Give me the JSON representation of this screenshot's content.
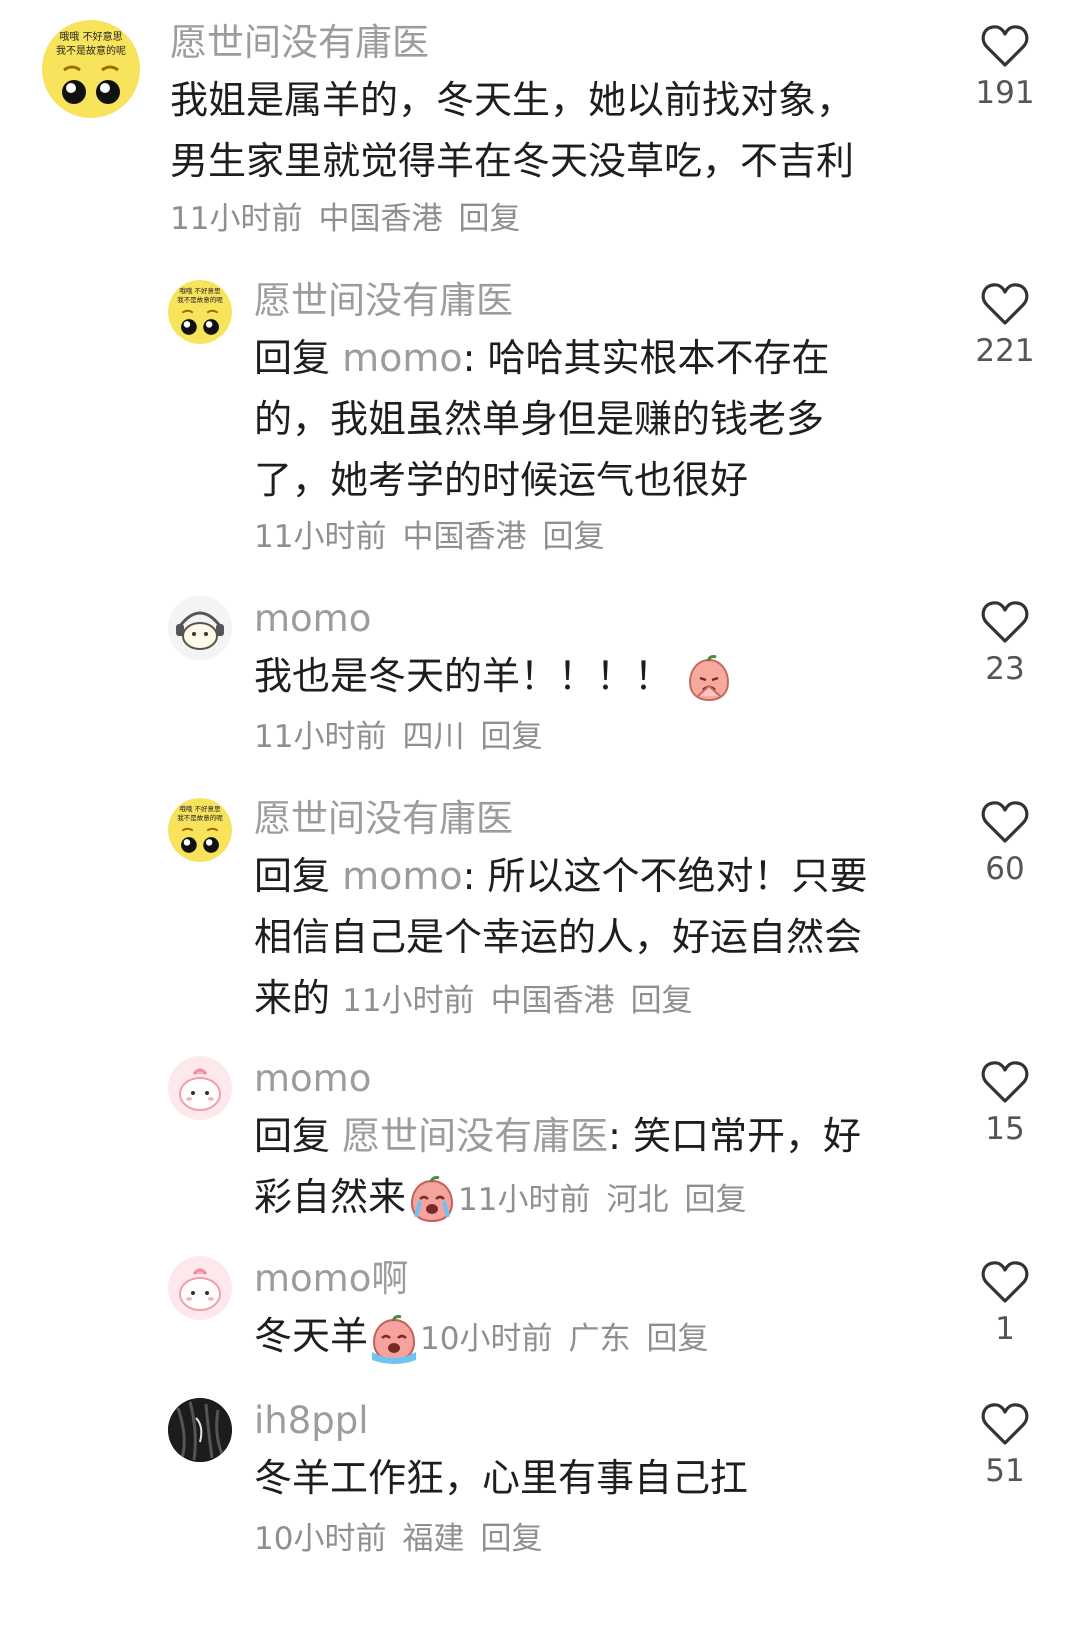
{
  "comments": [
    {
      "avatar": "cartoon-emoji-face-with-text",
      "avatar_text": [
        "哦哦 不好意思",
        "我不是故意的呢"
      ],
      "name": "愿世间没有庸医",
      "text": "我姐是属羊的，冬天生，她以前找对象，男生家里就觉得羊在冬天没草吃，不吉利",
      "time": "11小时前",
      "location": "中国香港",
      "reply": "回复",
      "likes": "191"
    },
    {
      "avatar": "cartoon-emoji-face-with-text",
      "avatar_text": [
        "哦哦 不好意思",
        "我不是故意的呢"
      ],
      "name": "愿世间没有庸医",
      "reply_prefix": "回复",
      "reply_to": "momo",
      "text": ": 哈哈其实根本不存在的，我姐虽然单身但是赚的钱老多了，她考学的时候运气也很好",
      "time": "11小时前",
      "location": "中国香港",
      "reply": "回复",
      "likes": "221"
    },
    {
      "avatar": "cartoon-cat-with-headphones",
      "name": "momo",
      "text": "我也是冬天的羊！！！！",
      "emoji": "peach-praying-emoji",
      "time": "11小时前",
      "location": "四川",
      "reply": "回复",
      "likes": "23"
    },
    {
      "avatar": "cartoon-emoji-face-with-text",
      "avatar_text": [
        "哦哦 不好意思",
        "我不是故意的呢"
      ],
      "name": "愿世间没有庸医",
      "reply_prefix": "回复",
      "reply_to": "momo",
      "text": ": 所以这个不绝对！只要相信自己是个幸运的人，好运自然会来的",
      "time": "11小时前",
      "location": "中国香港",
      "reply": "回复",
      "likes": "60"
    },
    {
      "avatar": "pink-cartoon-blob",
      "name": "momo",
      "reply_prefix": "回复",
      "reply_to": "愿世间没有庸医",
      "text": ": 笑口常开，好彩自然来",
      "emoji": "peach-crying-emoji",
      "time": "11小时前",
      "location": "河北",
      "reply": "回复",
      "likes": "15"
    },
    {
      "avatar": "pink-cartoon-blob",
      "name": "momo啊",
      "text": "冬天羊",
      "emoji": "peach-crying-emoji",
      "time": "10小时前",
      "location": "广东",
      "reply": "回复",
      "likes": "1"
    },
    {
      "avatar": "dark-hair-photo",
      "name": "ih8ppl",
      "text": "冬羊工作狂，心里有事自己扛",
      "time": "10小时前",
      "location": "福建",
      "reply": "回复",
      "likes": "51"
    }
  ]
}
